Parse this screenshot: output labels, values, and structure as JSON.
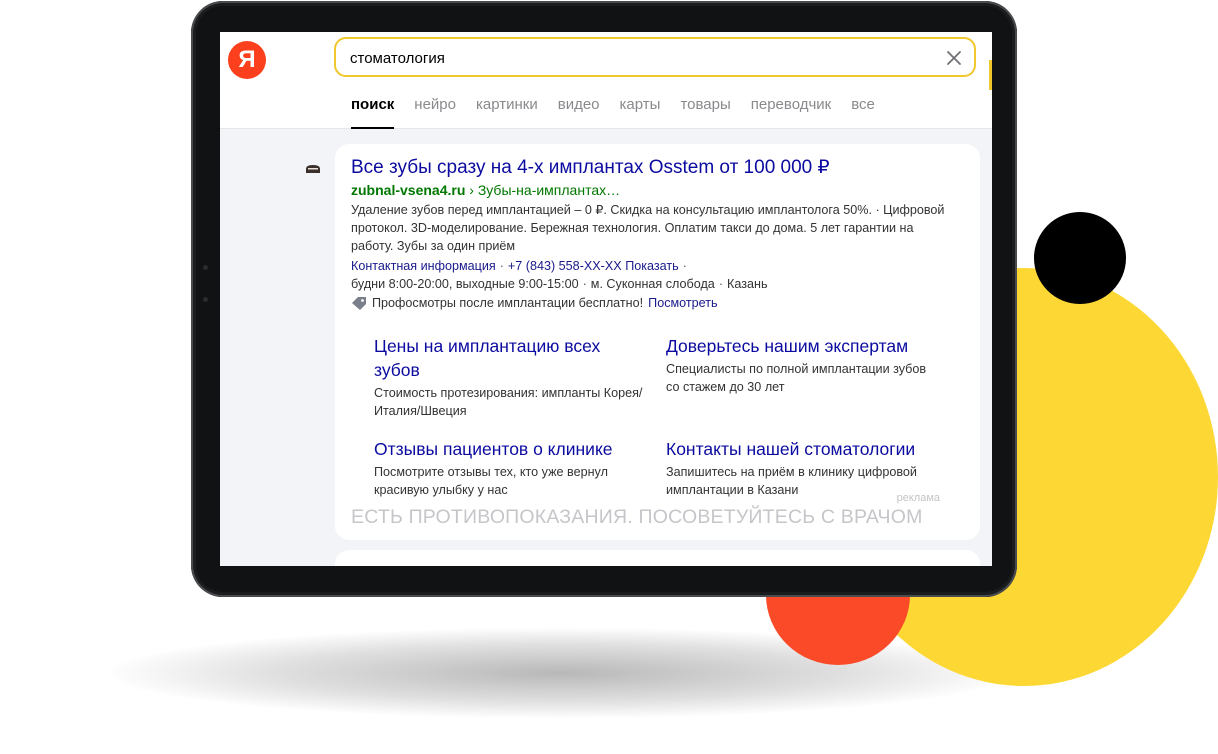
{
  "colors": {
    "deco_yellow": "#fdd835",
    "deco_red": "#fa4a27",
    "deco_black": "#000000",
    "logo": "#fc3f1d",
    "search_border": "#f0c82e",
    "link": "#0c0ba0",
    "url": "#007700"
  },
  "header": {
    "logo_text": "Я",
    "search": {
      "value": "стоматология"
    },
    "tabs": [
      {
        "label": "поиск",
        "active": true
      },
      {
        "label": "нейро"
      },
      {
        "label": "картинки"
      },
      {
        "label": "видео"
      },
      {
        "label": "карты"
      },
      {
        "label": "товары"
      },
      {
        "label": "переводчик"
      },
      {
        "label": "все"
      }
    ]
  },
  "ad": {
    "favicon_icon": "tooth-logo-icon",
    "title": "Все зубы сразу на 4-х имплантах Osstem от 100 000 ₽",
    "url_domain": "zubnal-vsena4.ru",
    "url_path": "› Зубы-на-имплантах…",
    "description": "Удаление зубов перед имплантацией – 0 ₽. Скидка на консультацию имплантолога 50%. · Цифровой протокол. 3D-моделирование. Бережная технология. Оплатим такси до дома. 5 лет гарантии на работу. Зубы за один приём",
    "contacts": {
      "contact_info": "Контактная информация",
      "phone": "+7 (843) 558-XX-XX",
      "show": "Показать",
      "hours": "будни 8:00-20:00, выходные 9:00-15:00",
      "metro": "м. Суконная слобода",
      "city": "Казань"
    },
    "promo": {
      "icon": "tag-icon",
      "text": "Профосмотры после имплантации бесплатно!",
      "link": "Посмотреть"
    },
    "sitelinks": [
      {
        "title": "Цены на имплантацию всех зубов",
        "desc": "Стоимость протезирования: импланты Корея/Италия/Швеция"
      },
      {
        "title": "Доверьтесь нашим экспертам",
        "desc": "Специалисты по полной имплантации зубов со стажем до 30 лет"
      },
      {
        "title": "Отзывы пациентов о клинике",
        "desc": "Посмотрите отзывы тех, кто уже вернул красивую улыбку у нас"
      },
      {
        "title": "Контакты нашей стоматологии",
        "desc": "Запишитесь на приём в клинику цифровой имплантации в Казани"
      }
    ],
    "label": "реклама",
    "disclaimer": "ЕСТЬ ПРОТИВОПОКАЗАНИЯ. ПОСОВЕТУЙТЕСЬ С ВРАЧОМ"
  }
}
